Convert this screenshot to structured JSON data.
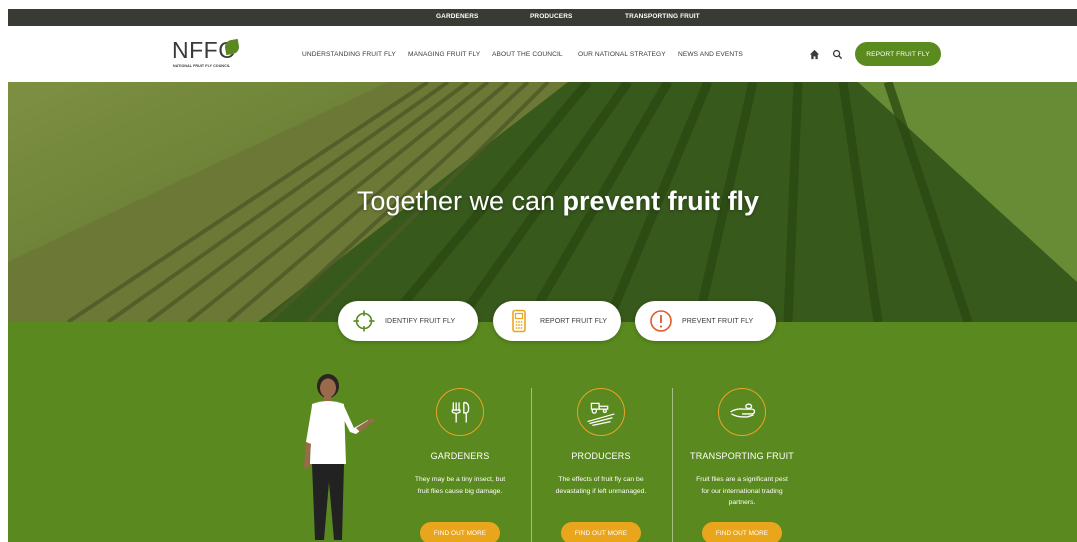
{
  "topbar": {
    "links": [
      "GARDENERS",
      "PRODUCERS",
      "TRANSPORTING FRUIT"
    ]
  },
  "header": {
    "logo_text": "NFFC",
    "logo_subtitle": "NATIONAL FRUIT FLY COUNCIL",
    "nav": [
      "UNDERSTANDING FRUIT FLY",
      "MANAGING FRUIT FLY",
      "ABOUT THE COUNCIL",
      "OUR NATIONAL STRATEGY",
      "NEWS AND EVENTS"
    ],
    "home_icon": "home-icon",
    "search_icon": "search-icon",
    "report_button": "REPORT FRUIT FLY"
  },
  "hero": {
    "title_regular": "Together we can ",
    "title_bold": "prevent fruit fly"
  },
  "pills": [
    {
      "label": "IDENTIFY FRUIT FLY",
      "icon": "crosshair-icon"
    },
    {
      "label": "REPORT FRUIT FLY",
      "icon": "phone-icon"
    },
    {
      "label": "PREVENT FRUIT FLY",
      "icon": "alert-icon"
    }
  ],
  "columns": [
    {
      "title": "GARDENERS",
      "text": [
        "They may be a tiny insect, but",
        "fruit flies cause big damage."
      ],
      "button": "FIND OUT MORE",
      "icon": "garden-tools-icon"
    },
    {
      "title": "PRODUCERS",
      "text": [
        "The effects of fruit fly can be",
        "devastating if left unmanaged."
      ],
      "button": "FIND OUT MORE",
      "icon": "tractor-field-icon"
    },
    {
      "title": "TRANSPORTING FRUIT",
      "text": [
        "Fruit flies are a significant pest",
        "for our international trading",
        "partners."
      ],
      "button": "FIND OUT MORE",
      "icon": "hand-fruit-icon"
    }
  ],
  "colors": {
    "topbar": "#383a34",
    "brand_green": "#5a8a1f",
    "accent_orange": "#e9a61d"
  }
}
